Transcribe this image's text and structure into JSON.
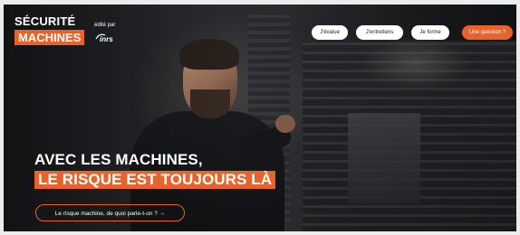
{
  "brand": {
    "line1": "SÉCURITÉ",
    "line2": "MACHINES",
    "publisher_label": "édité par",
    "publisher_logo_text": "inrs",
    "accent_color": "#e8632b"
  },
  "nav": {
    "items": [
      {
        "label": "J'évalue",
        "style": "white"
      },
      {
        "label": "J'entretiens",
        "style": "white"
      },
      {
        "label": "Je forme",
        "style": "white"
      },
      {
        "label": "Une question ?",
        "style": "orange"
      }
    ]
  },
  "hero": {
    "headline_line1": "AVEC LES MACHINES,",
    "headline_line2": "LE RISQUE EST TOUJOURS LÀ",
    "cta_label": "Le risque machine, de quoi parle-t-on ? →"
  }
}
